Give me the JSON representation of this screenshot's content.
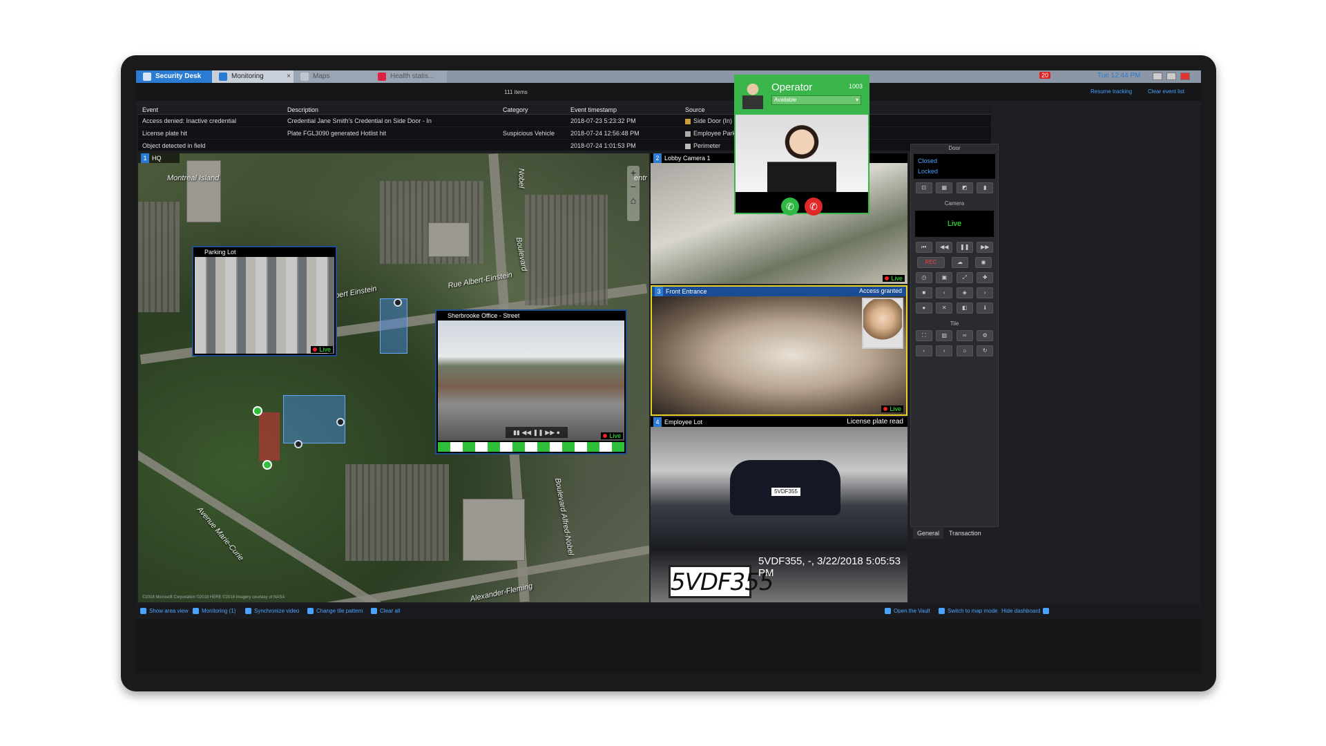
{
  "tabs": [
    {
      "label": "Security Desk"
    },
    {
      "label": "Monitoring"
    },
    {
      "label": "Maps"
    },
    {
      "label": "Health statis..."
    }
  ],
  "tray": {
    "time": "Tue 12:44 PM",
    "notif_count": "20"
  },
  "toolbar": {
    "items_count": "111 items",
    "resume": "Resume tracking",
    "clear": "Clear event list"
  },
  "events": {
    "headers": [
      "Event",
      "Description",
      "Category",
      "Event timestamp",
      "Source"
    ],
    "rows": [
      [
        "Access denied: Inactive credential",
        "Credential Jane Smith's Credential on Side Door - In",
        "",
        "2018-07-23 5:23:32 PM",
        "Side Door (In)"
      ],
      [
        "License plate hit",
        "Plate FGL3090 generated Hotlist hit",
        "Suspicious Vehicle",
        "2018-07-24 12:56:48 PM",
        "Employee Parking Lot"
      ],
      [
        "Object detected in field",
        "",
        "",
        "2018-07-24 1:01:53 PM",
        "Perimeter"
      ]
    ]
  },
  "map": {
    "tile_num": "1",
    "title": "HQ",
    "labels": {
      "montreal": "Montreal Island",
      "albert": "Albert Einstein",
      "rue_albert": "Rue Albert-Einstein",
      "boulevard": "Boulevard",
      "nobel": "Nobel",
      "marie": "Avenue Marie-Curie",
      "fleming": "Alexander-Fleming",
      "alfred": "Boulevard Alfred-Nobel",
      "entr": "entr"
    },
    "parking_popup": "Parking Lot",
    "street_popup": "Sherbrooke Office - Street",
    "live": "Live",
    "copyright": "©2018 Microsoft Corporation ©2018 HERE ©2018 Imagery courtesy of NASA"
  },
  "tiles": {
    "lobby": {
      "num": "2",
      "title": "Lobby Camera 1"
    },
    "entrance": {
      "num": "3",
      "title": "Front Entrance",
      "status": "Access granted"
    },
    "lot": {
      "num": "4",
      "title": "Employee Lot",
      "status": "License plate read",
      "plate": "5VDF355",
      "plate_small": "5VDF355",
      "read": "5VDF355, -, 3/22/2018 5:05:53 PM"
    }
  },
  "call": {
    "name": "Operator",
    "ext": "1003",
    "status": "Available"
  },
  "dashboard": {
    "door_title": "Door",
    "door_states": [
      "Closed",
      "Locked"
    ],
    "camera_title": "Camera",
    "camera_state": "Live",
    "rec": "REC",
    "tile_title": "Tile",
    "tabs": [
      "General",
      "Transaction"
    ]
  },
  "bottom": [
    "Show area view",
    "Monitoring (1)",
    "Synchronize video",
    "Change tile pattern",
    "Clear all",
    "Open the Vault",
    "Switch to map mode",
    "Hide dashboard"
  ]
}
